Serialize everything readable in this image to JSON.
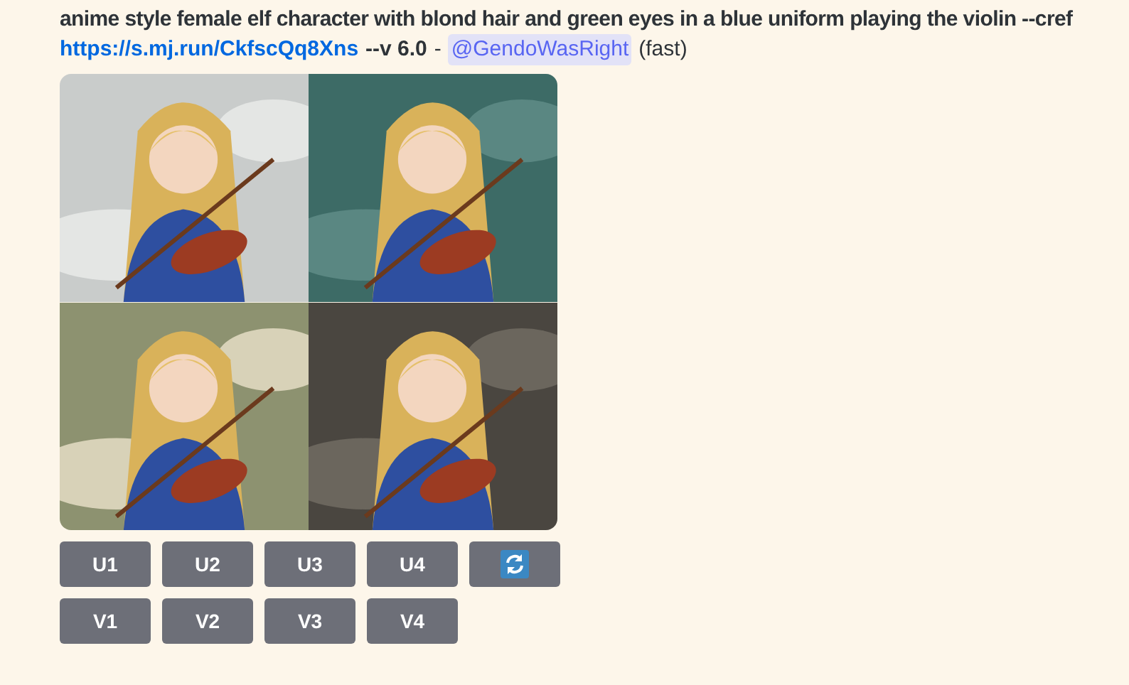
{
  "message": {
    "prompt": "anime style female elf character with blond hair and green eyes in a blue uniform playing the violin --cref",
    "link": "https://s.mj.run/CkfscQq8Xns",
    "params": "--v 6.0",
    "separator": "-",
    "mention": "@GendoWasRight",
    "speed": "(fast)"
  },
  "images": [
    {
      "kind": "picture"
    },
    {
      "kind": "picture"
    },
    {
      "kind": "picture"
    },
    {
      "kind": "picture"
    }
  ],
  "button_rows": [
    [
      {
        "kind": "label",
        "label": "U1"
      },
      {
        "kind": "label",
        "label": "U2"
      },
      {
        "kind": "label",
        "label": "U3"
      },
      {
        "kind": "label",
        "label": "U4"
      },
      {
        "kind": "refresh"
      }
    ],
    [
      {
        "kind": "label",
        "label": "V1"
      },
      {
        "kind": "label",
        "label": "V2"
      },
      {
        "kind": "label",
        "label": "V3"
      },
      {
        "kind": "label",
        "label": "V4"
      }
    ]
  ]
}
